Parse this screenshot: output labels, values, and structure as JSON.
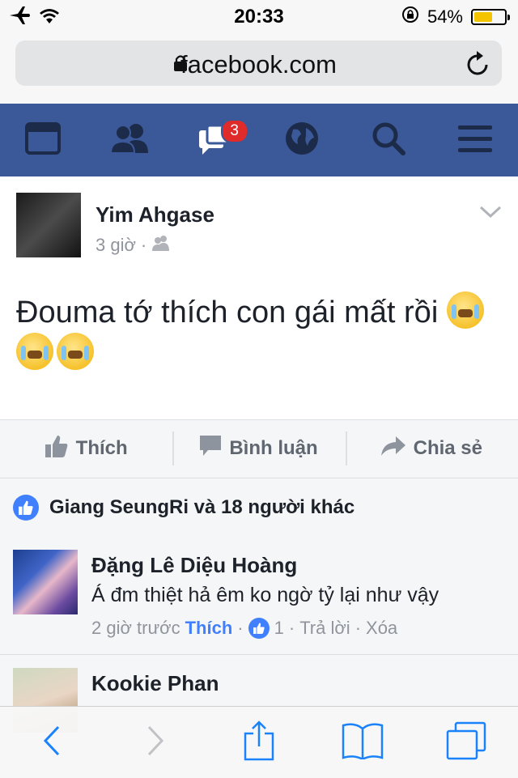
{
  "status": {
    "time": "20:33",
    "battery": "54%"
  },
  "browser": {
    "url": "facebook.com"
  },
  "nav": {
    "messages_badge": "3"
  },
  "post": {
    "author": "Yim Ahgase",
    "time": "3 giờ",
    "separator": "·",
    "text": "Đouma tớ thích con gái mất rồi"
  },
  "actions": {
    "like": "Thích",
    "comment": "Bình luận",
    "share": "Chia sẻ"
  },
  "likes": {
    "text": "Giang SeungRi và 18 người khác"
  },
  "comments": [
    {
      "name": "Đặng Lê Diệu Hoàng",
      "text": "Á đm thiệt hả êm ko ngờ tỷ lại như vậy",
      "time": "2 giờ trước",
      "sep": "·",
      "like": "Thích",
      "like_count": "1",
      "reply": "Trả lời",
      "delete": "Xóa"
    },
    {
      "name": "Kookie Phan"
    }
  ],
  "colors": {
    "fb_blue": "#3b5998",
    "link_blue": "#4080ff",
    "badge_red": "#e02b2b",
    "ios_blue": "#1a82fb"
  }
}
